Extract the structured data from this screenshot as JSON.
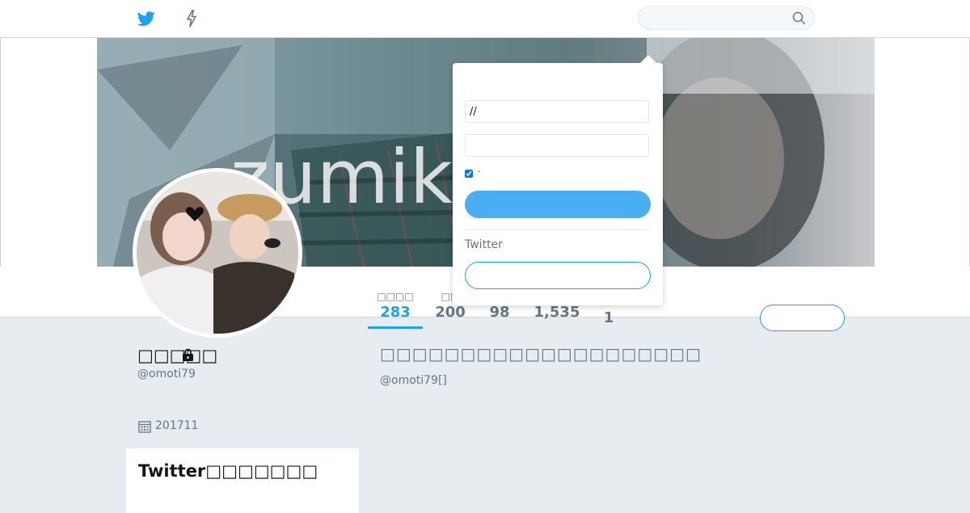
{
  "brand": {
    "accent": "#1da1f2",
    "text_secondary": "#657786",
    "background": "#e6ecf0"
  },
  "header": {
    "search": {
      "placeholder": ""
    },
    "icons": [
      "twitter-bird-icon",
      "moments-bolt-icon",
      "search-icon"
    ]
  },
  "banner": {
    "text": "zumiko"
  },
  "profile": {
    "name": "□□□□□",
    "handle": "@omoti79",
    "joined": "201711",
    "protected_title": "□□□□□□□□□□□□□□□□□□□□",
    "protected_handle": "@omoti79[]"
  },
  "stats": [
    {
      "label": "□□□□",
      "value": "283",
      "active": true
    },
    {
      "label": "□□",
      "value": "200",
      "active": false
    },
    {
      "label": "",
      "value": "98",
      "active": false
    },
    {
      "label": "",
      "value": "1,535",
      "active": false
    },
    {
      "label": "",
      "value": "1",
      "active": false
    }
  ],
  "follow_button": {
    "label": ""
  },
  "new_card": {
    "title": "Twitter□□□□□□□"
  },
  "login": {
    "username_value": "//",
    "password_value": "",
    "remember_checked": true,
    "remember_label": "·",
    "login_label": "",
    "new_to_label": "Twitter",
    "signup_label": ""
  }
}
